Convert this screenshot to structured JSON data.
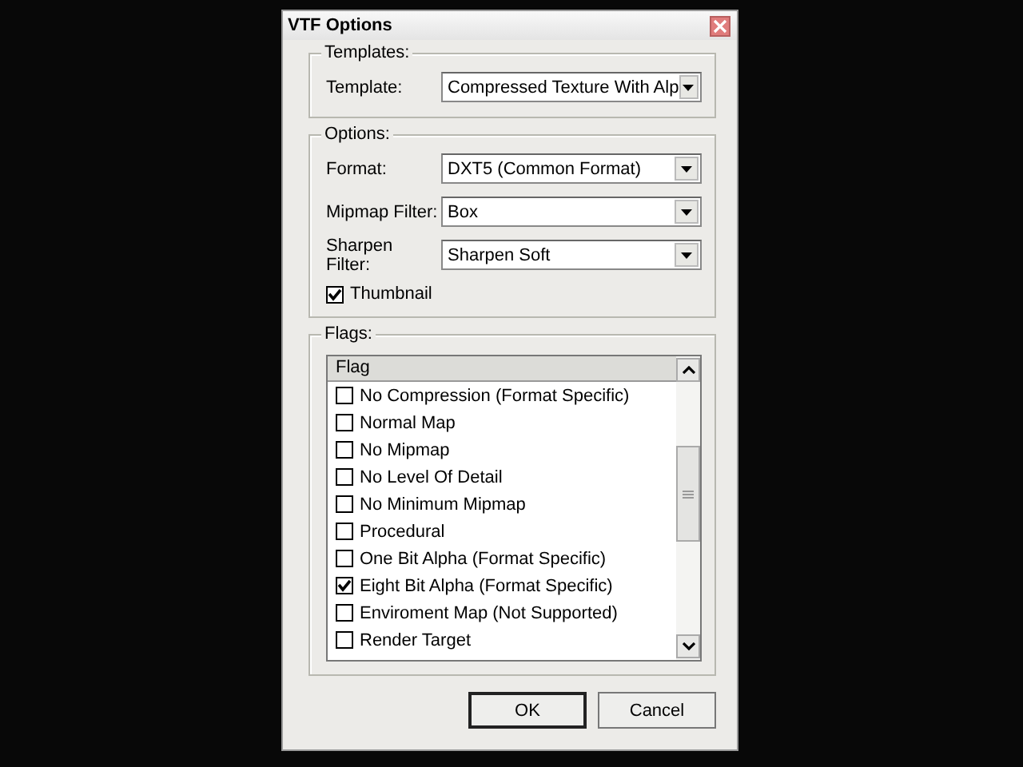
{
  "window": {
    "title": "VTF Options"
  },
  "templates": {
    "legend": "Templates:",
    "fields": [
      {
        "label": "Template:",
        "value": "Compressed Texture With Alp"
      }
    ]
  },
  "options": {
    "legend": "Options:",
    "fields": [
      {
        "label": "Format:",
        "value": "DXT5 (Common Format)"
      },
      {
        "label": "Mipmap Filter:",
        "value": "Box"
      },
      {
        "label": "Sharpen Filter:",
        "value": "Sharpen Soft"
      }
    ],
    "thumbnail": {
      "label": "Thumbnail",
      "checked": true
    }
  },
  "flags": {
    "legend": "Flags:",
    "column": "Flag",
    "items": [
      {
        "label": "No Compression (Format Specific)",
        "checked": false
      },
      {
        "label": "Normal Map",
        "checked": false
      },
      {
        "label": "No Mipmap",
        "checked": false
      },
      {
        "label": "No Level Of Detail",
        "checked": false
      },
      {
        "label": "No Minimum Mipmap",
        "checked": false
      },
      {
        "label": "Procedural",
        "checked": false
      },
      {
        "label": "One Bit Alpha (Format Specific)",
        "checked": false
      },
      {
        "label": "Eight Bit Alpha (Format Specific)",
        "checked": true
      },
      {
        "label": "Enviroment Map (Not Supported)",
        "checked": false
      },
      {
        "label": "Render Target",
        "checked": false
      }
    ]
  },
  "buttons": [
    {
      "label": "OK",
      "default": true
    },
    {
      "label": "Cancel",
      "default": false
    }
  ]
}
